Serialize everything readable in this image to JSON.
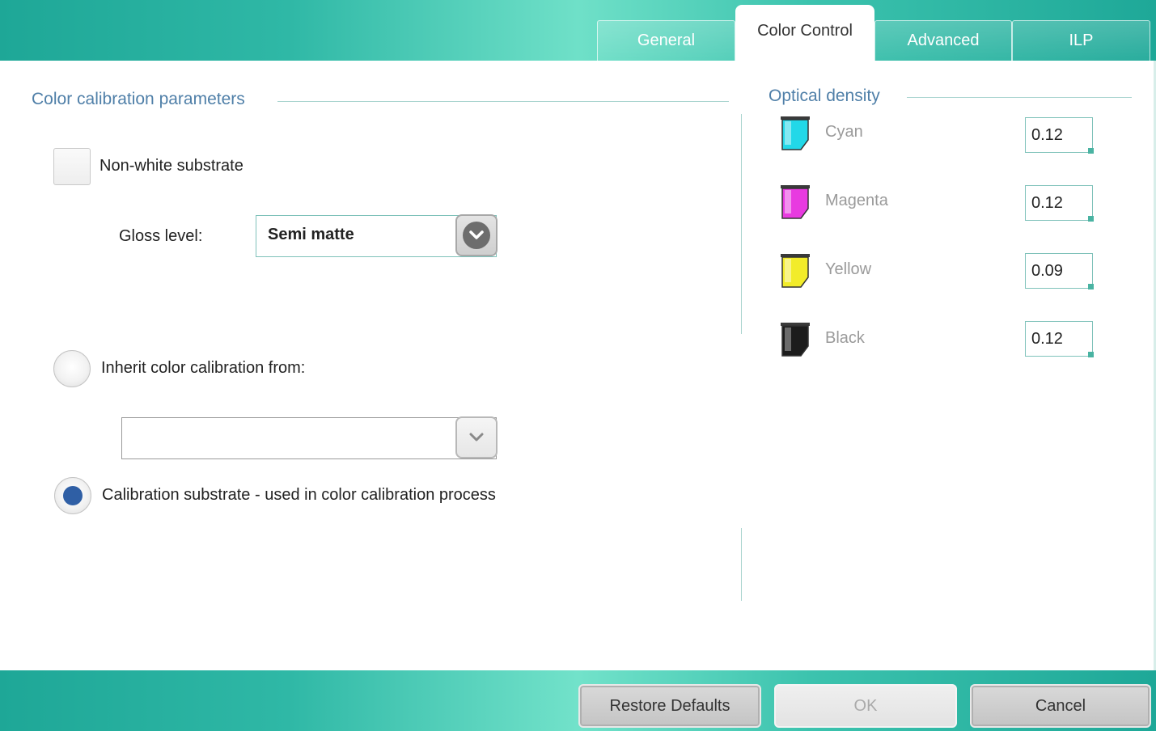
{
  "tabs": [
    {
      "label": "General",
      "active": false
    },
    {
      "label": "Color Control",
      "active": true
    },
    {
      "label": "Advanced",
      "active": false
    },
    {
      "label": "ILP",
      "active": false
    }
  ],
  "calibration": {
    "section_title": "Color calibration parameters",
    "non_white_label": "Non-white substrate",
    "non_white_checked": false,
    "gloss_label": "Gloss level:",
    "gloss_value": "Semi matte",
    "inherit_label": "Inherit color calibration from:",
    "inherit_value": "",
    "calibration_substrate_label": "Calibration substrate - used in color calibration process",
    "selected_option": "calibration_substrate"
  },
  "optical_density": {
    "section_title": "Optical density",
    "inks": [
      {
        "name": "Cyan",
        "value": "0.12",
        "color": "#22d8e8"
      },
      {
        "name": "Magenta",
        "value": "0.12",
        "color": "#e83ae0"
      },
      {
        "name": "Yellow",
        "value": "0.09",
        "color": "#f2ec2a"
      },
      {
        "name": "Black",
        "value": "0.12",
        "color": "#1c1c1c"
      }
    ]
  },
  "footer": {
    "restore_label": "Restore Defaults",
    "ok_label": "OK",
    "ok_enabled": false,
    "cancel_label": "Cancel"
  }
}
